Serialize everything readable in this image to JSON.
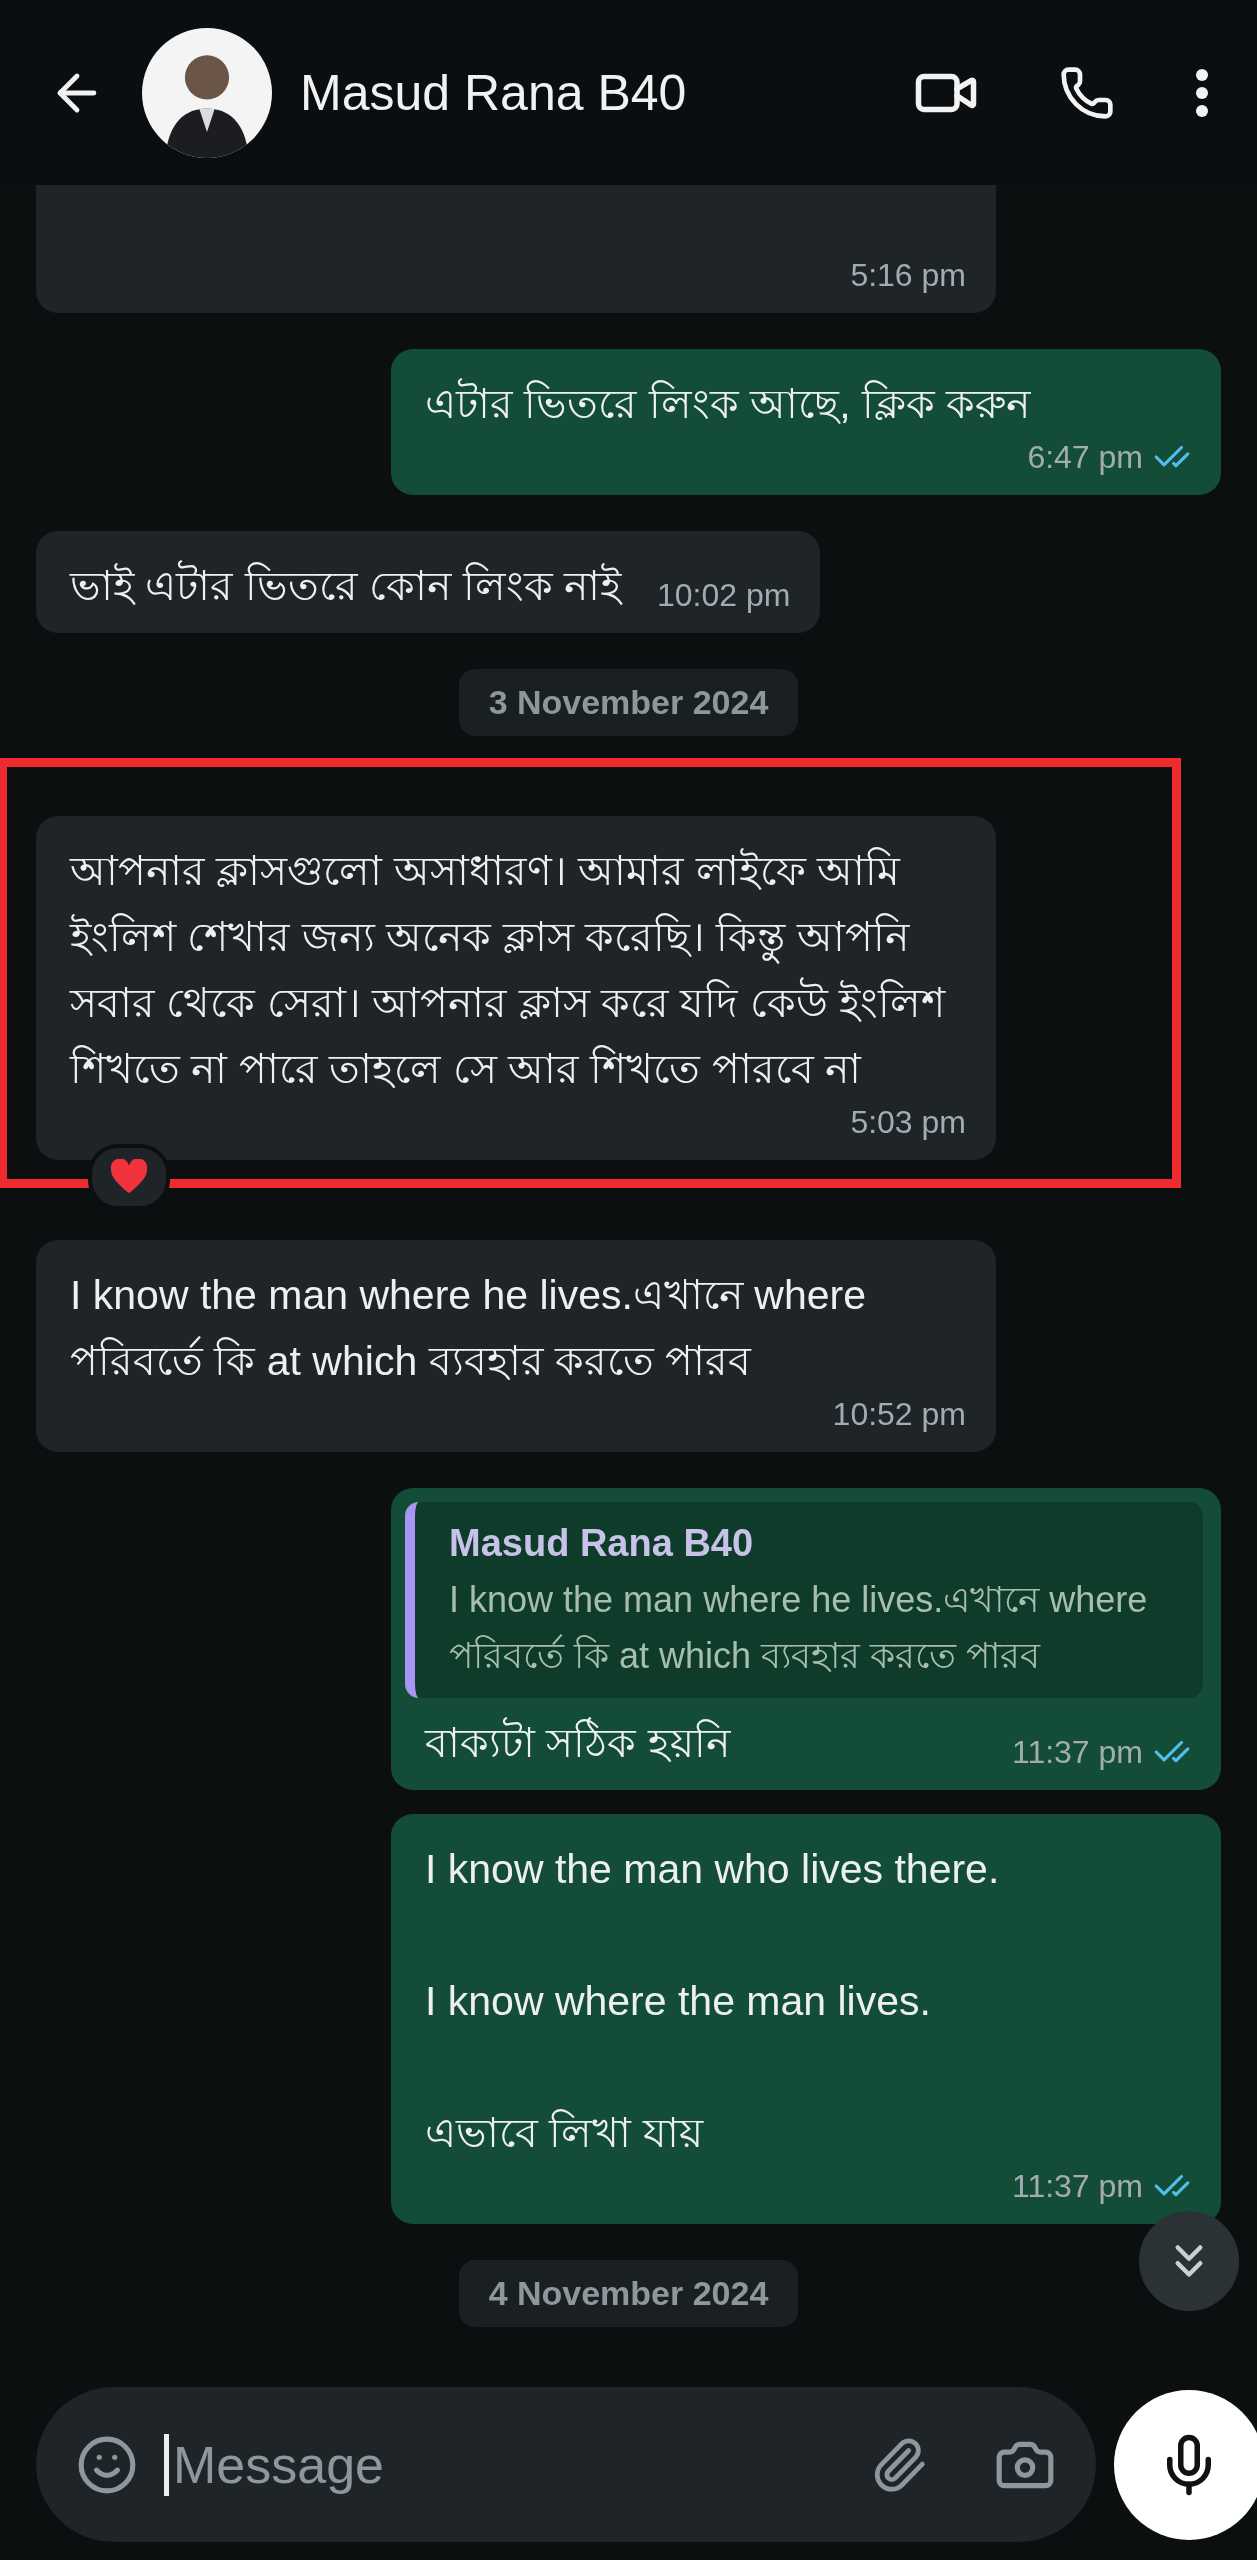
{
  "header": {
    "contact_name": "Masud Rana B40"
  },
  "messages": [
    {
      "kind": "in",
      "time": "5:16 pm"
    },
    {
      "kind": "out",
      "text": "এটার ভিতরে লিংক আছে, ক্লিক করুন",
      "time": "6:47 pm",
      "read": true
    },
    {
      "kind": "in",
      "text": "ভাই এটার ভিতরে কোন লিংক নাই",
      "time": "10:02 pm"
    },
    {
      "kind": "date",
      "text": "3 November 2024"
    },
    {
      "kind": "in",
      "text": "আপনার ক্লাসগুলো অসাধারণ। আমার লাইফে আমি ইংলিশ শেখার জন্য অনেক ক্লাস করেছি। কিন্তু আপনি সবার থেকে সেরা। আপনার ক্লাস করে যদি কেউ ইংলিশ শিখতে না পারে তাহলে সে আর শিখতে পারবে না",
      "time": "5:03 pm",
      "highlighted": true,
      "heart_reaction": true
    },
    {
      "kind": "in",
      "text": "I know the man where he lives.এখানে where পরিবর্তে কি at which ব্যবহার করতে পারব",
      "time": "10:52 pm"
    },
    {
      "kind": "out",
      "quote": {
        "author": "Masud Rana B40",
        "text": "I know the man where he lives.এখানে where পরিবর্তে কি at which ব্যবহার করতে পারব"
      },
      "text": "বাক্যটা সঠিক হয়নি",
      "time": "11:37 pm",
      "read": true
    },
    {
      "kind": "out",
      "text": "I know the man who lives there.\n\nI know where the man lives.\n\nএভাবে লিখা যায়",
      "time": "11:37 pm",
      "read": true
    },
    {
      "kind": "date",
      "text": "4 November 2024"
    }
  ],
  "composer": {
    "placeholder": "Message"
  }
}
